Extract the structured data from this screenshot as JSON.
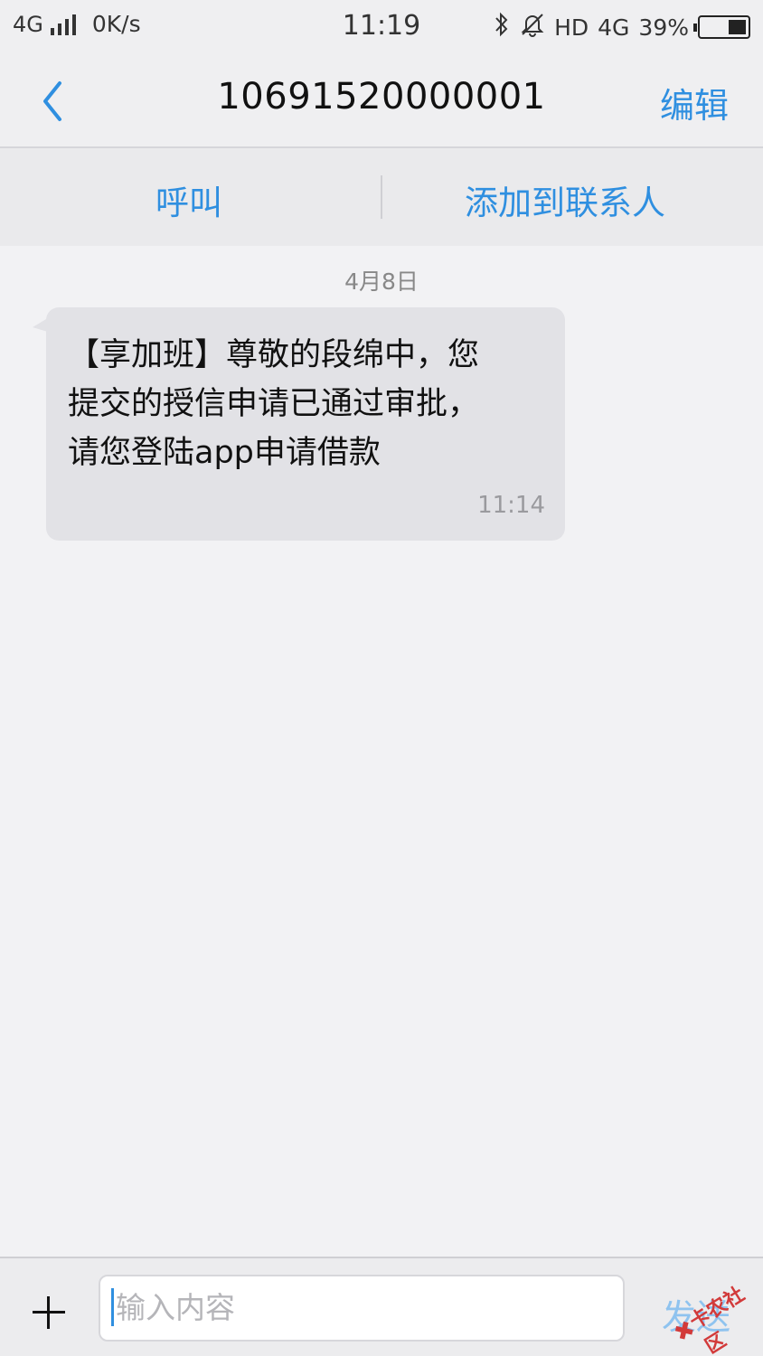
{
  "status_bar": {
    "network": "4G",
    "speed": "0K/s",
    "time": "11:19",
    "hd": "HD",
    "network_right": "4G",
    "battery": "39%",
    "battery_level": 0.39,
    "icons": [
      "signal-icon",
      "bluetooth-icon",
      "mute-bell-icon",
      "battery-icon"
    ]
  },
  "nav": {
    "back_icon": "chevron-left-icon",
    "title": "10691520000001",
    "edit_label": "编辑"
  },
  "actions": {
    "call_label": "呼叫",
    "add_contact_label": "添加到联系人"
  },
  "conversation": {
    "date": "4月8日",
    "messages": [
      {
        "lines": [
          "【享加班】尊敬的段绵中，您",
          "提交的授信申请已通过审批，",
          "请您登陆app申请借款"
        ],
        "time": "11:14"
      }
    ]
  },
  "composer": {
    "plus_icon": "plus-icon",
    "placeholder": "输入内容",
    "send_label": "发送"
  },
  "watermark": {
    "text": "卡农社区"
  },
  "colors": {
    "accent": "#2f8fe0",
    "bubble": "#e2e2e6",
    "background": "#f2f2f4"
  }
}
